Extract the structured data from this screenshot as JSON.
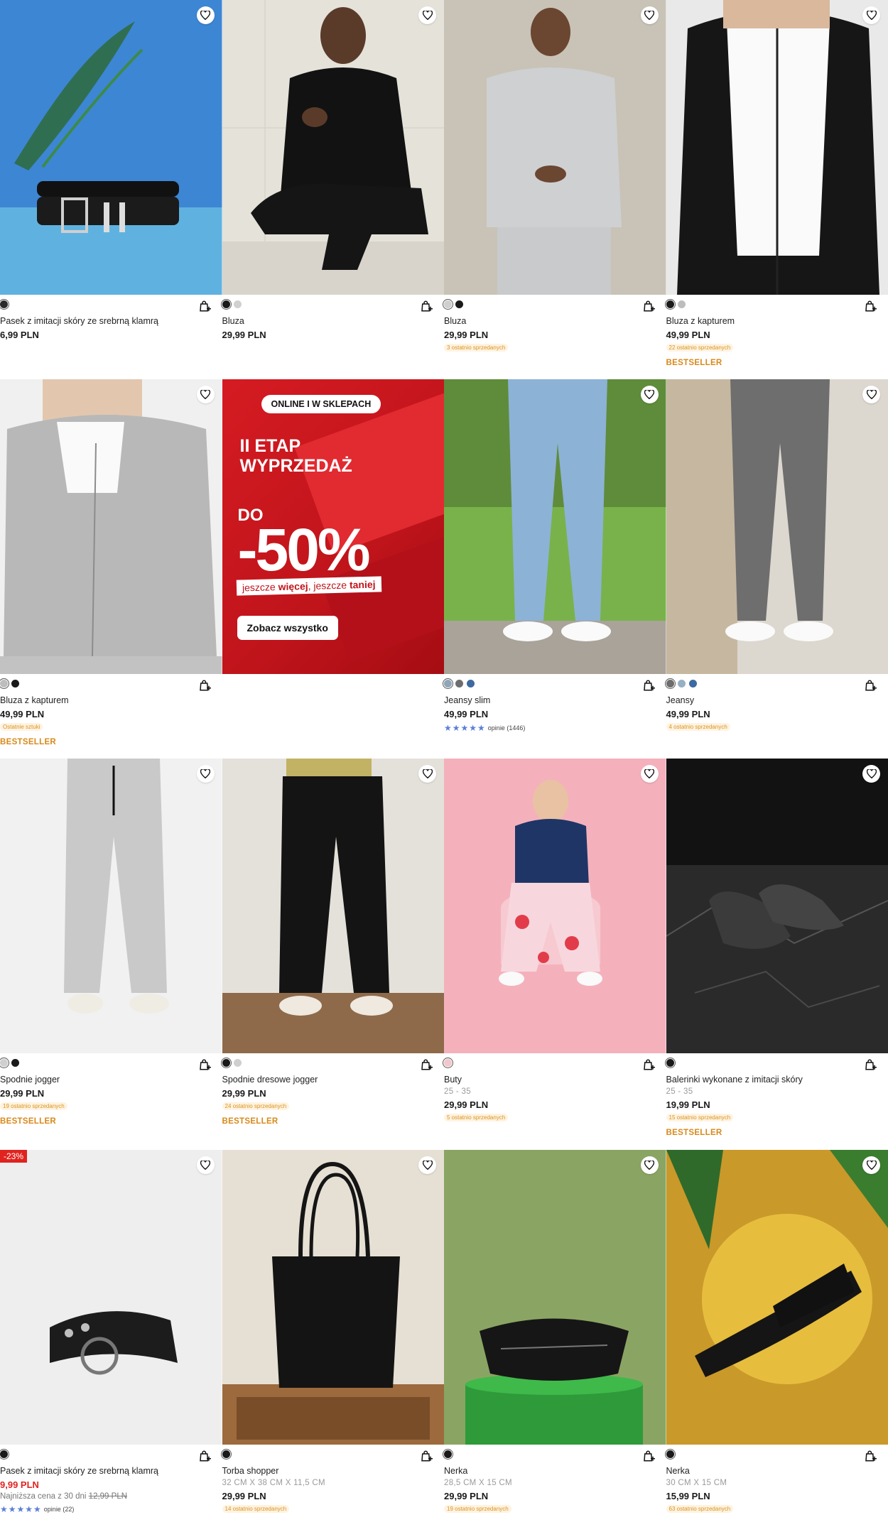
{
  "promo": {
    "pill": "ONLINE I W SKLEPACH",
    "heading_line1": "II ETAP",
    "heading_line2": "WYPRZEDAŻ",
    "do": "DO",
    "percent": "-50%",
    "strap_part1": "jeszcze ",
    "strap_bold": "więcej",
    "strap_part2": ", jeszcze ",
    "strap_bold2": "taniej",
    "cta": "Zobacz wszystko"
  },
  "products": [
    {
      "name": "Pasek z imitacji skóry ze srebrną klamrą",
      "price": "6,99 PLN",
      "swatches": [
        "#2b2b2b"
      ]
    },
    {
      "name": "Bluza",
      "price": "29,99 PLN",
      "swatches": [
        "#1a1a1a",
        "#d0d0d0"
      ]
    },
    {
      "name": "Bluza",
      "price": "29,99 PLN",
      "tag": "3 ostatnio sprzedanych",
      "swatches": [
        "#cfcfcf",
        "#1a1a1a"
      ]
    },
    {
      "name": "Bluza z kapturem",
      "price": "49,99 PLN",
      "tag": "22 ostatnio sprzedanych",
      "best": "BESTSELLER",
      "swatches": [
        "#1a1a1a",
        "#bdbdbd"
      ]
    },
    {
      "name": "Bluza z kapturem",
      "price": "49,99 PLN",
      "tag": "Ostatnie sztuki",
      "best": "BESTSELLER",
      "swatches": [
        "#bdbdbd",
        "#1a1a1a"
      ]
    },
    {
      "name": "Jeansy slim",
      "price": "49,99 PLN",
      "rating_text": "opinie (1446)",
      "swatches": [
        "#8fa6b8",
        "#6d6d6d",
        "#3d6aa0"
      ]
    },
    {
      "name": "Jeansy",
      "price": "49,99 PLN",
      "tag": "4 ostatnio sprzedanych",
      "swatches": [
        "#6d6d6d",
        "#98b0c4",
        "#3d6aa0"
      ]
    },
    {
      "name": "Spodnie jogger",
      "price": "29,99 PLN",
      "tag": "19 ostatnio sprzedanych",
      "best": "BESTSELLER",
      "swatches": [
        "#cfcfcf",
        "#1a1a1a"
      ]
    },
    {
      "name": "Spodnie dresowe jogger",
      "price": "29,99 PLN",
      "tag": "24 ostatnio sprzedanych",
      "best": "BESTSELLER",
      "swatches": [
        "#1a1a1a",
        "#cfcfcf"
      ]
    },
    {
      "name": "Buty",
      "sub": "25 - 35",
      "price": "29,99 PLN",
      "tag": "5 ostatnio sprzedanych",
      "swatches": [
        "#f2c7cc"
      ]
    },
    {
      "name": "Balerinki wykonane z imitacji skóry",
      "sub": "25 - 35",
      "price": "19,99 PLN",
      "tag": "15 ostatnio sprzedanych",
      "best": "BESTSELLER",
      "swatches": [
        "#1a1a1a"
      ]
    },
    {
      "name": "Pasek z imitacji skóry ze srebrną klamrą",
      "price": "9,99 PLN",
      "lowest": "Najniższa cena z 30 dni",
      "lowest_old": "12,99 PLN",
      "rating_text": "opinie (22)",
      "discount": "-23%",
      "swatches": [
        "#1a1a1a"
      ]
    },
    {
      "name": "Torba shopper",
      "sub": "32 CM X 38 CM X 11,5 CM",
      "price": "29,99 PLN",
      "tag": "14 ostatnio sprzedanych",
      "swatches": [
        "#1a1a1a"
      ]
    },
    {
      "name": "Nerka",
      "sub": "28,5 CM X 15 CM",
      "price": "29,99 PLN",
      "tag": "19 ostatnio sprzedanych",
      "swatches": [
        "#1a1a1a"
      ]
    },
    {
      "name": "Nerka",
      "sub": "30 CM X 15 CM",
      "price": "15,99 PLN",
      "tag": "63 ostatnio sprzedanych",
      "swatches": [
        "#1a1a1a"
      ]
    }
  ],
  "icons": {
    "favorite": "heart-icon",
    "bag": "add-to-bag-icon",
    "star": "star-icon"
  },
  "colors": {
    "bestseller": "#d8891a",
    "tag_bg": "#fff3e1",
    "sale_red": "#e0231f",
    "rating_star": "#5b7fd6",
    "promo_red": "#d51b22"
  }
}
